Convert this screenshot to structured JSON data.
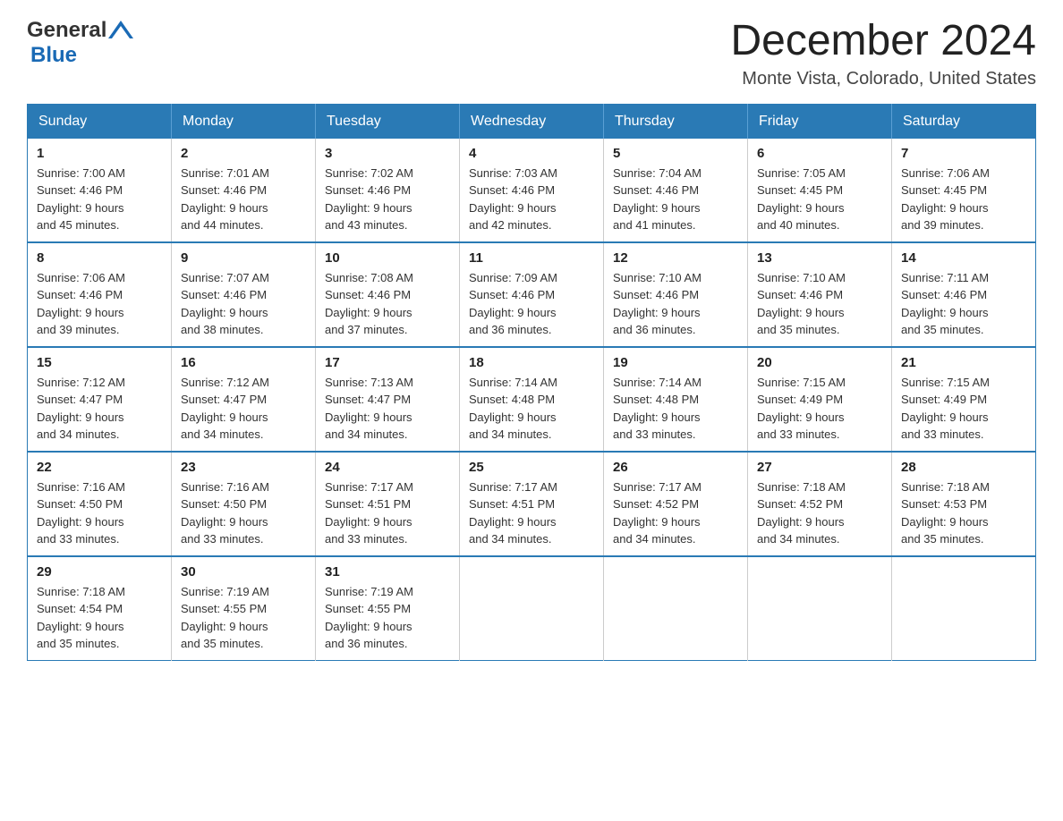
{
  "header": {
    "logo_general": "General",
    "logo_blue": "Blue",
    "title": "December 2024",
    "subtitle": "Monte Vista, Colorado, United States"
  },
  "days_of_week": [
    "Sunday",
    "Monday",
    "Tuesday",
    "Wednesday",
    "Thursday",
    "Friday",
    "Saturday"
  ],
  "weeks": [
    [
      {
        "day": "1",
        "sunrise": "Sunrise: 7:00 AM",
        "sunset": "Sunset: 4:46 PM",
        "daylight": "Daylight: 9 hours",
        "daylight2": "and 45 minutes."
      },
      {
        "day": "2",
        "sunrise": "Sunrise: 7:01 AM",
        "sunset": "Sunset: 4:46 PM",
        "daylight": "Daylight: 9 hours",
        "daylight2": "and 44 minutes."
      },
      {
        "day": "3",
        "sunrise": "Sunrise: 7:02 AM",
        "sunset": "Sunset: 4:46 PM",
        "daylight": "Daylight: 9 hours",
        "daylight2": "and 43 minutes."
      },
      {
        "day": "4",
        "sunrise": "Sunrise: 7:03 AM",
        "sunset": "Sunset: 4:46 PM",
        "daylight": "Daylight: 9 hours",
        "daylight2": "and 42 minutes."
      },
      {
        "day": "5",
        "sunrise": "Sunrise: 7:04 AM",
        "sunset": "Sunset: 4:46 PM",
        "daylight": "Daylight: 9 hours",
        "daylight2": "and 41 minutes."
      },
      {
        "day": "6",
        "sunrise": "Sunrise: 7:05 AM",
        "sunset": "Sunset: 4:45 PM",
        "daylight": "Daylight: 9 hours",
        "daylight2": "and 40 minutes."
      },
      {
        "day": "7",
        "sunrise": "Sunrise: 7:06 AM",
        "sunset": "Sunset: 4:45 PM",
        "daylight": "Daylight: 9 hours",
        "daylight2": "and 39 minutes."
      }
    ],
    [
      {
        "day": "8",
        "sunrise": "Sunrise: 7:06 AM",
        "sunset": "Sunset: 4:46 PM",
        "daylight": "Daylight: 9 hours",
        "daylight2": "and 39 minutes."
      },
      {
        "day": "9",
        "sunrise": "Sunrise: 7:07 AM",
        "sunset": "Sunset: 4:46 PM",
        "daylight": "Daylight: 9 hours",
        "daylight2": "and 38 minutes."
      },
      {
        "day": "10",
        "sunrise": "Sunrise: 7:08 AM",
        "sunset": "Sunset: 4:46 PM",
        "daylight": "Daylight: 9 hours",
        "daylight2": "and 37 minutes."
      },
      {
        "day": "11",
        "sunrise": "Sunrise: 7:09 AM",
        "sunset": "Sunset: 4:46 PM",
        "daylight": "Daylight: 9 hours",
        "daylight2": "and 36 minutes."
      },
      {
        "day": "12",
        "sunrise": "Sunrise: 7:10 AM",
        "sunset": "Sunset: 4:46 PM",
        "daylight": "Daylight: 9 hours",
        "daylight2": "and 36 minutes."
      },
      {
        "day": "13",
        "sunrise": "Sunrise: 7:10 AM",
        "sunset": "Sunset: 4:46 PM",
        "daylight": "Daylight: 9 hours",
        "daylight2": "and 35 minutes."
      },
      {
        "day": "14",
        "sunrise": "Sunrise: 7:11 AM",
        "sunset": "Sunset: 4:46 PM",
        "daylight": "Daylight: 9 hours",
        "daylight2": "and 35 minutes."
      }
    ],
    [
      {
        "day": "15",
        "sunrise": "Sunrise: 7:12 AM",
        "sunset": "Sunset: 4:47 PM",
        "daylight": "Daylight: 9 hours",
        "daylight2": "and 34 minutes."
      },
      {
        "day": "16",
        "sunrise": "Sunrise: 7:12 AM",
        "sunset": "Sunset: 4:47 PM",
        "daylight": "Daylight: 9 hours",
        "daylight2": "and 34 minutes."
      },
      {
        "day": "17",
        "sunrise": "Sunrise: 7:13 AM",
        "sunset": "Sunset: 4:47 PM",
        "daylight": "Daylight: 9 hours",
        "daylight2": "and 34 minutes."
      },
      {
        "day": "18",
        "sunrise": "Sunrise: 7:14 AM",
        "sunset": "Sunset: 4:48 PM",
        "daylight": "Daylight: 9 hours",
        "daylight2": "and 34 minutes."
      },
      {
        "day": "19",
        "sunrise": "Sunrise: 7:14 AM",
        "sunset": "Sunset: 4:48 PM",
        "daylight": "Daylight: 9 hours",
        "daylight2": "and 33 minutes."
      },
      {
        "day": "20",
        "sunrise": "Sunrise: 7:15 AM",
        "sunset": "Sunset: 4:49 PM",
        "daylight": "Daylight: 9 hours",
        "daylight2": "and 33 minutes."
      },
      {
        "day": "21",
        "sunrise": "Sunrise: 7:15 AM",
        "sunset": "Sunset: 4:49 PM",
        "daylight": "Daylight: 9 hours",
        "daylight2": "and 33 minutes."
      }
    ],
    [
      {
        "day": "22",
        "sunrise": "Sunrise: 7:16 AM",
        "sunset": "Sunset: 4:50 PM",
        "daylight": "Daylight: 9 hours",
        "daylight2": "and 33 minutes."
      },
      {
        "day": "23",
        "sunrise": "Sunrise: 7:16 AM",
        "sunset": "Sunset: 4:50 PM",
        "daylight": "Daylight: 9 hours",
        "daylight2": "and 33 minutes."
      },
      {
        "day": "24",
        "sunrise": "Sunrise: 7:17 AM",
        "sunset": "Sunset: 4:51 PM",
        "daylight": "Daylight: 9 hours",
        "daylight2": "and 33 minutes."
      },
      {
        "day": "25",
        "sunrise": "Sunrise: 7:17 AM",
        "sunset": "Sunset: 4:51 PM",
        "daylight": "Daylight: 9 hours",
        "daylight2": "and 34 minutes."
      },
      {
        "day": "26",
        "sunrise": "Sunrise: 7:17 AM",
        "sunset": "Sunset: 4:52 PM",
        "daylight": "Daylight: 9 hours",
        "daylight2": "and 34 minutes."
      },
      {
        "day": "27",
        "sunrise": "Sunrise: 7:18 AM",
        "sunset": "Sunset: 4:52 PM",
        "daylight": "Daylight: 9 hours",
        "daylight2": "and 34 minutes."
      },
      {
        "day": "28",
        "sunrise": "Sunrise: 7:18 AM",
        "sunset": "Sunset: 4:53 PM",
        "daylight": "Daylight: 9 hours",
        "daylight2": "and 35 minutes."
      }
    ],
    [
      {
        "day": "29",
        "sunrise": "Sunrise: 7:18 AM",
        "sunset": "Sunset: 4:54 PM",
        "daylight": "Daylight: 9 hours",
        "daylight2": "and 35 minutes."
      },
      {
        "day": "30",
        "sunrise": "Sunrise: 7:19 AM",
        "sunset": "Sunset: 4:55 PM",
        "daylight": "Daylight: 9 hours",
        "daylight2": "and 35 minutes."
      },
      {
        "day": "31",
        "sunrise": "Sunrise: 7:19 AM",
        "sunset": "Sunset: 4:55 PM",
        "daylight": "Daylight: 9 hours",
        "daylight2": "and 36 minutes."
      },
      null,
      null,
      null,
      null
    ]
  ],
  "colors": {
    "header_bg": "#2a7ab5",
    "header_text": "#ffffff",
    "border": "#2a7ab5",
    "accent_blue": "#1a6ab5"
  }
}
